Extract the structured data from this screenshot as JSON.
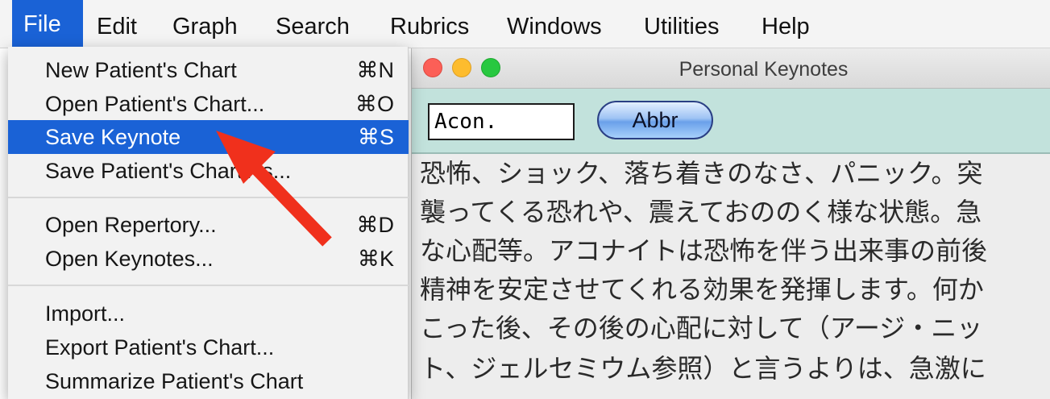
{
  "menubar": {
    "items": [
      "File",
      "Edit",
      "Graph",
      "Search",
      "Rubrics",
      "Windows",
      "Utilities",
      "Help"
    ],
    "active": "File"
  },
  "file_menu": {
    "groups": [
      [
        {
          "label": "New Patient's Chart",
          "shortcut": "⌘N"
        },
        {
          "label": "Open Patient's Chart...",
          "shortcut": "⌘O"
        },
        {
          "label": "Save Keynote",
          "shortcut": "⌘S",
          "highlighted": true
        },
        {
          "label": "Save Patient's Chart As...",
          "shortcut": ""
        }
      ],
      [
        {
          "label": "Open Repertory...",
          "shortcut": "⌘D"
        },
        {
          "label": "Open Keynotes...",
          "shortcut": "⌘K"
        }
      ],
      [
        {
          "label": "Import...",
          "shortcut": ""
        },
        {
          "label": "Export Patient's Chart...",
          "shortcut": ""
        },
        {
          "label": "Summarize Patient's Chart",
          "shortcut": ""
        }
      ]
    ]
  },
  "keynotes_window": {
    "title": "Personal Keynotes",
    "abbr_input_value": "Acon.",
    "abbr_button_label": "Abbr",
    "body_lines": [
      "恐怖、ショック、落ち着きのなさ、パニック。突",
      "襲ってくる恐れや、震えておののく様な状態。急",
      "な心配等。アコナイトは恐怖を伴う出来事の前後",
      "精神を安定させてくれる効果を発揮します。何か",
      "こった後、その後の心配に対して（アージ・ニッ",
      "ト、ジェルセミウム参照）と言うよりは、急激に"
    ]
  },
  "colors": {
    "menu_highlight": "#1a62d6",
    "toolbar_bg": "#c2e2dc",
    "annotation_arrow": "#f0301c"
  }
}
